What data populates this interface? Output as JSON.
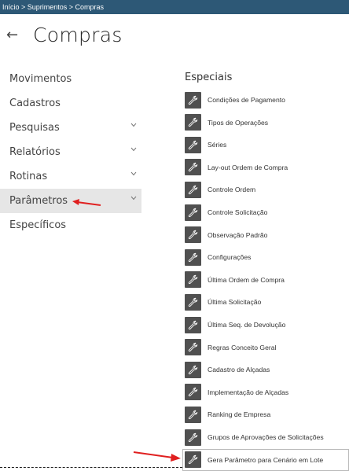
{
  "breadcrumb": "Início > Suprimentos > Compras",
  "header": {
    "back_icon": "←",
    "title": "Compras"
  },
  "nav": [
    {
      "label": "Movimentos",
      "chevron": false
    },
    {
      "label": "Cadastros",
      "chevron": false
    },
    {
      "label": "Pesquisas",
      "chevron": true
    },
    {
      "label": "Relatórios",
      "chevron": true
    },
    {
      "label": "Rotinas",
      "chevron": true
    },
    {
      "label": "Parâmetros",
      "chevron": true,
      "active": true
    },
    {
      "label": "Específicos",
      "chevron": false
    }
  ],
  "especiais": {
    "title": "Especiais",
    "items": [
      "Condições de Pagamento",
      "Tipos de Operações",
      "Séries",
      "Lay-out Ordem de Compra",
      "Controle Ordem",
      "Controle Solicitação",
      "Observação Padrão",
      "Configurações",
      "Última Ordem de Compra",
      "Última Solicitação",
      "Última Seq. de Devolução",
      "Regras Conceito Geral",
      "Cadastro de Alçadas",
      "Implementação de Alçadas",
      "Ranking de Empresa",
      "Grupos de Aprovações de Solicitações",
      "Gera Parâmetro para Cenário em Lote"
    ]
  },
  "icons": {
    "item_icon": "wrench-icon",
    "annotation": "red-arrow"
  },
  "colors": {
    "topbar": "#2d5876",
    "icon_bg": "#505050",
    "arrow": "#e02020"
  }
}
